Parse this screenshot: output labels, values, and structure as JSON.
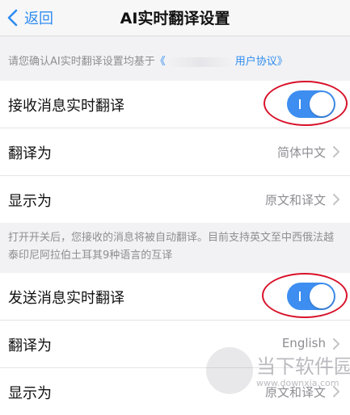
{
  "nav": {
    "back_label": "返回",
    "title": "AI实时翻译设置"
  },
  "notice": {
    "text": "请您确认AI实时翻译设置均基于",
    "link_open": "《",
    "link_tail": "用户协议》"
  },
  "receive": {
    "toggle_label": "接收消息实时翻译",
    "toggle_on": true,
    "translate_to_label": "翻译为",
    "translate_to_value": "简体中文",
    "display_label": "显示为",
    "display_value": "原文和译文"
  },
  "description": "打开开关后，您接收的消息将被自动翻译。目前支持英文至中西俄法越泰印尼阿拉伯土耳其9种语言的互译",
  "send": {
    "toggle_label": "发送消息实时翻译",
    "toggle_on": true,
    "translate_to_label": "翻译为",
    "translate_to_value": "English",
    "display_label": "显示为",
    "display_value": "原文和译文"
  },
  "watermark": {
    "name": "当下软件园",
    "url": "www.downxia.com"
  },
  "colors": {
    "accent": "#2f8cf0",
    "toggle_on": "#3d8ef0",
    "annotation": "#d8122a"
  }
}
